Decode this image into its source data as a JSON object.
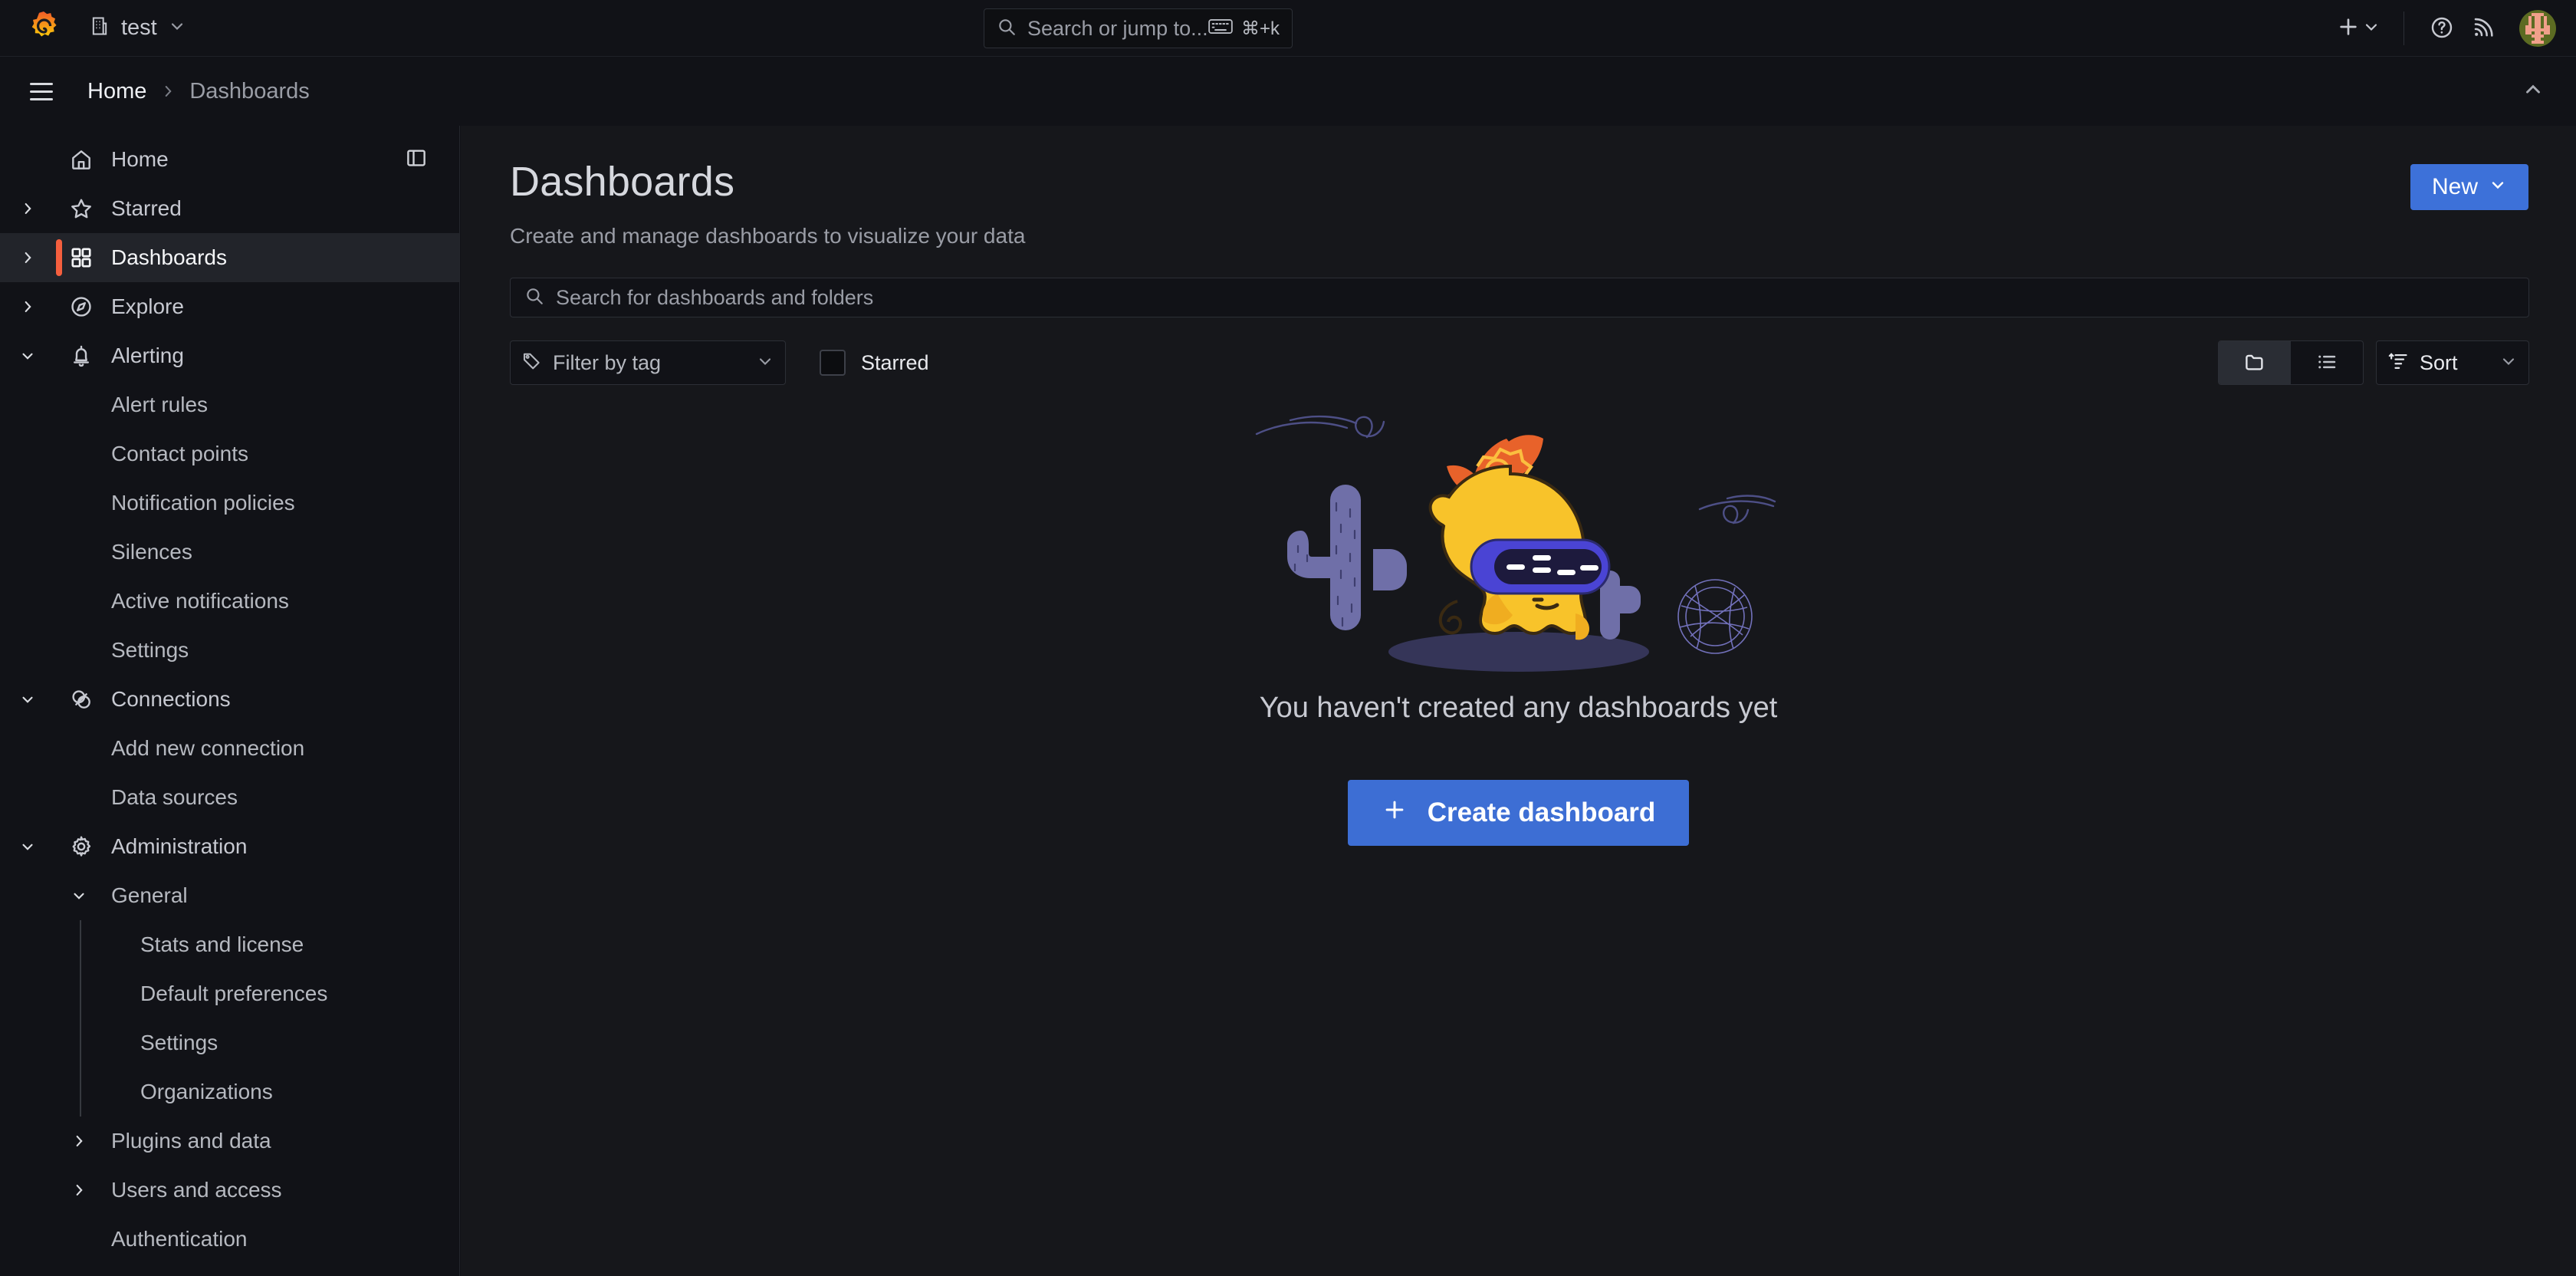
{
  "topbar": {
    "org_name": "test",
    "org_icon": "building-icon",
    "logo_icon": "grafana-logo",
    "search": {
      "placeholder": "Search or jump to...",
      "icon": "search-icon",
      "kbd_icon": "keyboard-icon",
      "kbd_shortcut": "⌘+k"
    },
    "actions": {
      "new_icon": "plus-icon",
      "new_chevron": "chevron-down-icon",
      "help_icon": "question-circle-icon",
      "news_icon": "rss-icon",
      "avatar": "user-avatar"
    }
  },
  "breadcrumb": {
    "menu_icon": "hamburger-menu-icon",
    "items": [
      "Home",
      "Dashboards"
    ],
    "separator_icon": "chevron-right-icon",
    "collapse_icon": "chevron-up-icon"
  },
  "sidebar": {
    "dock_icon": "dock-menu-icon",
    "active_accent": "#f55f3e",
    "items": [
      {
        "label": "Home",
        "icon": "home-icon",
        "level": 1,
        "twisty": "none",
        "active": false
      },
      {
        "label": "Starred",
        "icon": "star-icon",
        "level": 1,
        "twisty": "right",
        "active": false
      },
      {
        "label": "Dashboards",
        "icon": "apps-grid-icon",
        "level": 1,
        "twisty": "right",
        "active": true
      },
      {
        "label": "Explore",
        "icon": "compass-icon",
        "level": 1,
        "twisty": "right",
        "active": false
      },
      {
        "label": "Alerting",
        "icon": "bell-icon",
        "level": 1,
        "twisty": "down",
        "active": false
      },
      {
        "label": "Alert rules",
        "icon": "none",
        "level": 2,
        "twisty": "none",
        "active": false
      },
      {
        "label": "Contact points",
        "icon": "none",
        "level": 2,
        "twisty": "none",
        "active": false
      },
      {
        "label": "Notification policies",
        "icon": "none",
        "level": 2,
        "twisty": "none",
        "active": false
      },
      {
        "label": "Silences",
        "icon": "none",
        "level": 2,
        "twisty": "none",
        "active": false
      },
      {
        "label": "Active notifications",
        "icon": "none",
        "level": 2,
        "twisty": "none",
        "active": false
      },
      {
        "label": "Settings",
        "icon": "none",
        "level": 2,
        "twisty": "none",
        "active": false
      },
      {
        "label": "Connections",
        "icon": "connections-icon",
        "level": 1,
        "twisty": "down",
        "active": false
      },
      {
        "label": "Add new connection",
        "icon": "none",
        "level": 2,
        "twisty": "none",
        "active": false
      },
      {
        "label": "Data sources",
        "icon": "none",
        "level": 2,
        "twisty": "none",
        "active": false
      },
      {
        "label": "Administration",
        "icon": "gear-icon",
        "level": 1,
        "twisty": "down",
        "active": false
      },
      {
        "label": "General",
        "icon": "none",
        "level": 2,
        "twisty": "down2",
        "active": false
      },
      {
        "label": "Stats and license",
        "icon": "none",
        "level": 3,
        "twisty": "none",
        "active": false
      },
      {
        "label": "Default preferences",
        "icon": "none",
        "level": 3,
        "twisty": "none",
        "active": false
      },
      {
        "label": "Settings",
        "icon": "none",
        "level": 3,
        "twisty": "none",
        "active": false
      },
      {
        "label": "Organizations",
        "icon": "none",
        "level": 3,
        "twisty": "none",
        "active": false
      },
      {
        "label": "Plugins and data",
        "icon": "none",
        "level": 2,
        "twisty": "right2",
        "active": false
      },
      {
        "label": "Users and access",
        "icon": "none",
        "level": 2,
        "twisty": "right2",
        "active": false
      },
      {
        "label": "Authentication",
        "icon": "none",
        "level": 2,
        "twisty": "none",
        "active": false
      }
    ]
  },
  "main": {
    "title": "Dashboards",
    "subtitle": "Create and manage dashboards to visualize your data",
    "new_button": {
      "label": "New",
      "chevron": "chevron-down-icon",
      "color": "#3d71d9"
    },
    "search": {
      "placeholder": "Search for dashboards and folders",
      "value": "",
      "icon": "search-icon"
    },
    "filter": {
      "tag_select": {
        "label": "Filter by tag",
        "icon": "tag-icon",
        "chevron": "chevron-down-icon"
      },
      "starred": {
        "label": "Starred",
        "checked": false
      },
      "view_toggle": {
        "folder_icon": "folder-icon",
        "list_icon": "list-ul-icon",
        "selected": "folder"
      },
      "sort": {
        "label": "Sort",
        "icon": "sort-amount-up-icon",
        "chevron": "chevron-down-icon"
      }
    },
    "empty_state": {
      "illustration": "grafana-mascot-vr-desert",
      "title": "You haven't created any dashboards yet",
      "cta": {
        "label": "Create dashboard",
        "icon": "plus-icon",
        "color": "#3d6ed4"
      }
    }
  }
}
